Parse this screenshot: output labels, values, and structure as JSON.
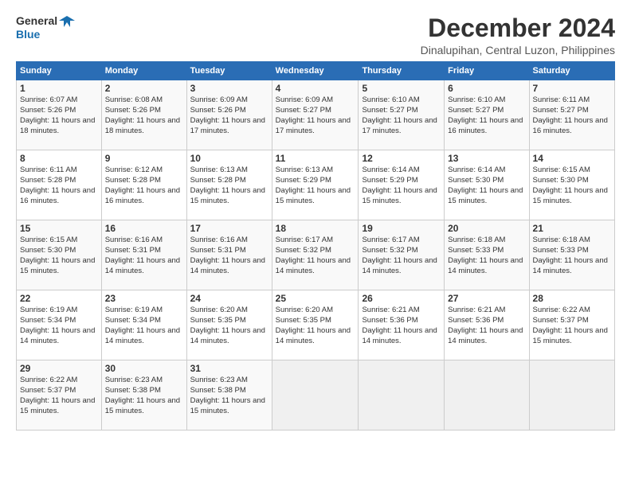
{
  "logo": {
    "line1": "General",
    "line2": "Blue"
  },
  "title": "December 2024",
  "subtitle": "Dinalupihan, Central Luzon, Philippines",
  "headers": [
    "Sunday",
    "Monday",
    "Tuesday",
    "Wednesday",
    "Thursday",
    "Friday",
    "Saturday"
  ],
  "weeks": [
    [
      {
        "day": "1",
        "sunrise": "6:07 AM",
        "sunset": "5:26 PM",
        "daylight": "11 hours and 18 minutes."
      },
      {
        "day": "2",
        "sunrise": "6:08 AM",
        "sunset": "5:26 PM",
        "daylight": "11 hours and 18 minutes."
      },
      {
        "day": "3",
        "sunrise": "6:09 AM",
        "sunset": "5:26 PM",
        "daylight": "11 hours and 17 minutes."
      },
      {
        "day": "4",
        "sunrise": "6:09 AM",
        "sunset": "5:27 PM",
        "daylight": "11 hours and 17 minutes."
      },
      {
        "day": "5",
        "sunrise": "6:10 AM",
        "sunset": "5:27 PM",
        "daylight": "11 hours and 17 minutes."
      },
      {
        "day": "6",
        "sunrise": "6:10 AM",
        "sunset": "5:27 PM",
        "daylight": "11 hours and 16 minutes."
      },
      {
        "day": "7",
        "sunrise": "6:11 AM",
        "sunset": "5:27 PM",
        "daylight": "11 hours and 16 minutes."
      }
    ],
    [
      {
        "day": "8",
        "sunrise": "6:11 AM",
        "sunset": "5:28 PM",
        "daylight": "11 hours and 16 minutes."
      },
      {
        "day": "9",
        "sunrise": "6:12 AM",
        "sunset": "5:28 PM",
        "daylight": "11 hours and 16 minutes."
      },
      {
        "day": "10",
        "sunrise": "6:13 AM",
        "sunset": "5:28 PM",
        "daylight": "11 hours and 15 minutes."
      },
      {
        "day": "11",
        "sunrise": "6:13 AM",
        "sunset": "5:29 PM",
        "daylight": "11 hours and 15 minutes."
      },
      {
        "day": "12",
        "sunrise": "6:14 AM",
        "sunset": "5:29 PM",
        "daylight": "11 hours and 15 minutes."
      },
      {
        "day": "13",
        "sunrise": "6:14 AM",
        "sunset": "5:30 PM",
        "daylight": "11 hours and 15 minutes."
      },
      {
        "day": "14",
        "sunrise": "6:15 AM",
        "sunset": "5:30 PM",
        "daylight": "11 hours and 15 minutes."
      }
    ],
    [
      {
        "day": "15",
        "sunrise": "6:15 AM",
        "sunset": "5:30 PM",
        "daylight": "11 hours and 15 minutes."
      },
      {
        "day": "16",
        "sunrise": "6:16 AM",
        "sunset": "5:31 PM",
        "daylight": "11 hours and 14 minutes."
      },
      {
        "day": "17",
        "sunrise": "6:16 AM",
        "sunset": "5:31 PM",
        "daylight": "11 hours and 14 minutes."
      },
      {
        "day": "18",
        "sunrise": "6:17 AM",
        "sunset": "5:32 PM",
        "daylight": "11 hours and 14 minutes."
      },
      {
        "day": "19",
        "sunrise": "6:17 AM",
        "sunset": "5:32 PM",
        "daylight": "11 hours and 14 minutes."
      },
      {
        "day": "20",
        "sunrise": "6:18 AM",
        "sunset": "5:33 PM",
        "daylight": "11 hours and 14 minutes."
      },
      {
        "day": "21",
        "sunrise": "6:18 AM",
        "sunset": "5:33 PM",
        "daylight": "11 hours and 14 minutes."
      }
    ],
    [
      {
        "day": "22",
        "sunrise": "6:19 AM",
        "sunset": "5:34 PM",
        "daylight": "11 hours and 14 minutes."
      },
      {
        "day": "23",
        "sunrise": "6:19 AM",
        "sunset": "5:34 PM",
        "daylight": "11 hours and 14 minutes."
      },
      {
        "day": "24",
        "sunrise": "6:20 AM",
        "sunset": "5:35 PM",
        "daylight": "11 hours and 14 minutes."
      },
      {
        "day": "25",
        "sunrise": "6:20 AM",
        "sunset": "5:35 PM",
        "daylight": "11 hours and 14 minutes."
      },
      {
        "day": "26",
        "sunrise": "6:21 AM",
        "sunset": "5:36 PM",
        "daylight": "11 hours and 14 minutes."
      },
      {
        "day": "27",
        "sunrise": "6:21 AM",
        "sunset": "5:36 PM",
        "daylight": "11 hours and 14 minutes."
      },
      {
        "day": "28",
        "sunrise": "6:22 AM",
        "sunset": "5:37 PM",
        "daylight": "11 hours and 15 minutes."
      }
    ],
    [
      {
        "day": "29",
        "sunrise": "6:22 AM",
        "sunset": "5:37 PM",
        "daylight": "11 hours and 15 minutes."
      },
      {
        "day": "30",
        "sunrise": "6:23 AM",
        "sunset": "5:38 PM",
        "daylight": "11 hours and 15 minutes."
      },
      {
        "day": "31",
        "sunrise": "6:23 AM",
        "sunset": "5:38 PM",
        "daylight": "11 hours and 15 minutes."
      },
      null,
      null,
      null,
      null
    ]
  ]
}
